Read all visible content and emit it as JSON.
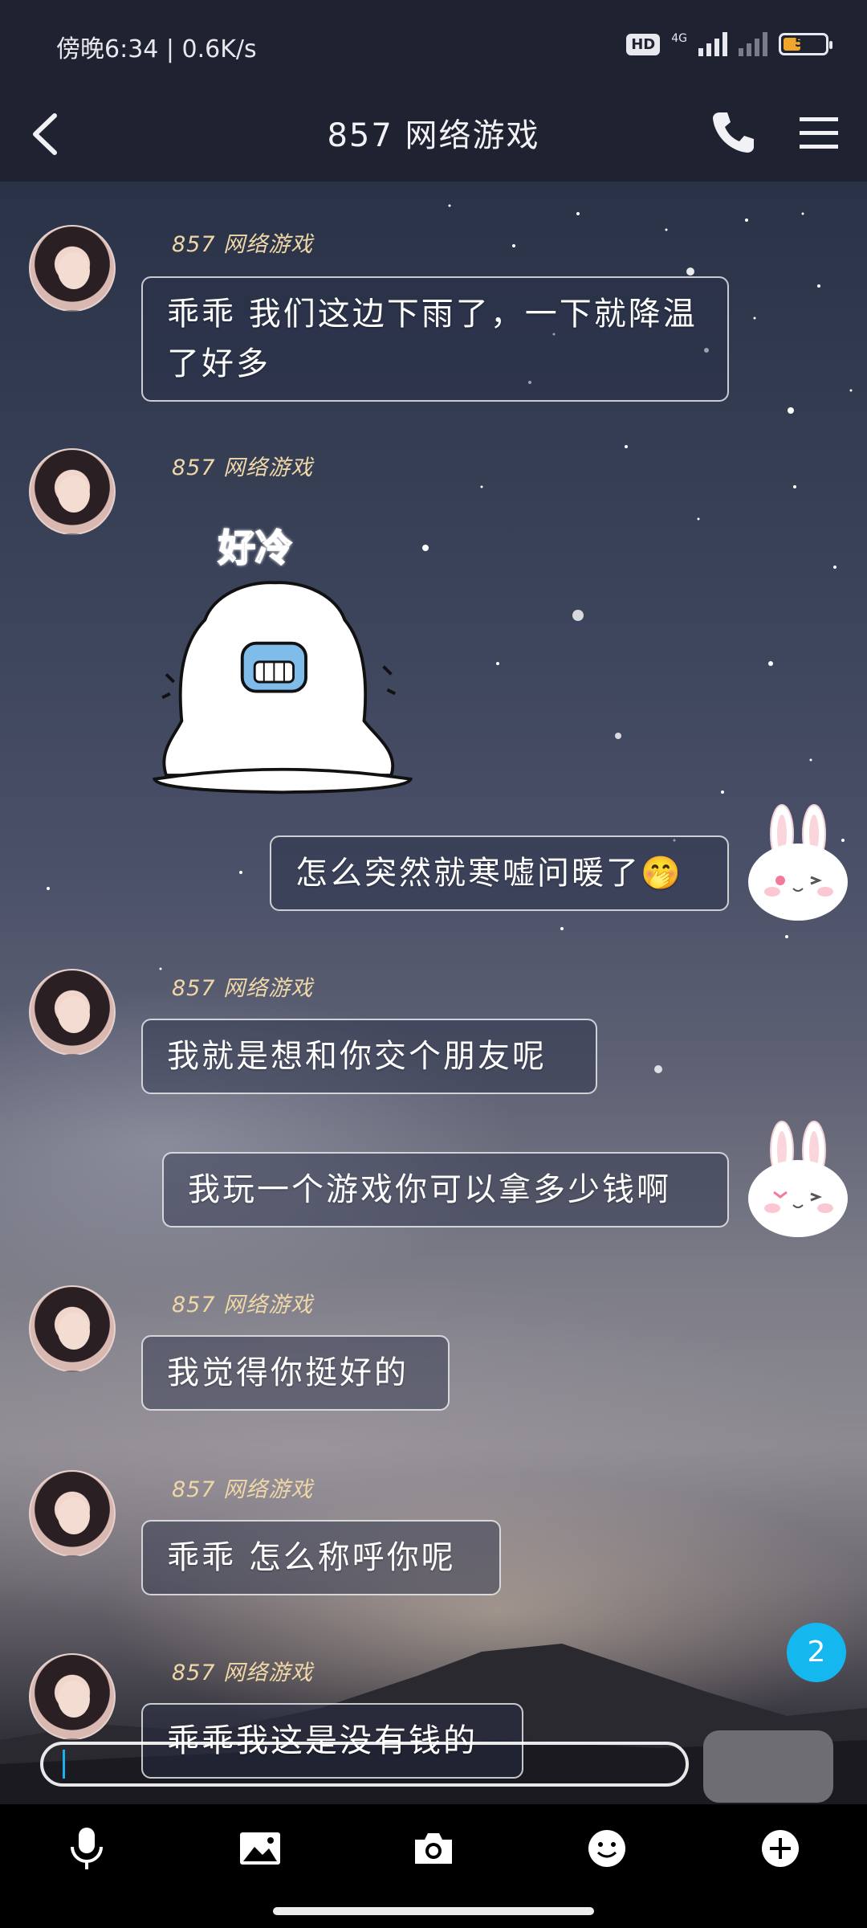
{
  "status_bar": {
    "time_speed": "傍晚6:34 | 0.6K/s",
    "hd_badge": "HD",
    "network": "4G",
    "battery": "53"
  },
  "header": {
    "back_icon": "chevron-left-icon",
    "title": "857 网络游戏",
    "phone_icon": "phone-icon",
    "menu_icon": "hamburger-menu-icon"
  },
  "messages": [
    {
      "side": "left",
      "sender": "857 网络游戏",
      "text": "乖乖 我们这边下雨了，一下就降温了好多"
    },
    {
      "side": "left",
      "sender": "857 网络游戏",
      "type": "sticker",
      "sticker_text": "好冷"
    },
    {
      "side": "right",
      "text": "怎么突然就寒嘘问暖了🤭"
    },
    {
      "side": "left",
      "sender": "857 网络游戏",
      "text": "我就是想和你交个朋友呢"
    },
    {
      "side": "right",
      "text": "我玩一个游戏你可以拿多少钱啊"
    },
    {
      "side": "left",
      "sender": "857 网络游戏",
      "text": "我觉得你挺好的"
    },
    {
      "side": "left",
      "sender": "857 网络游戏",
      "text": "乖乖 怎么称呼你呢"
    },
    {
      "side": "left",
      "sender": "857 网络游戏",
      "text": "乖乖我这是没有钱的"
    }
  ],
  "unread_count": "2",
  "toolbar": {
    "items": [
      "microphone-icon",
      "image-icon",
      "camera-icon",
      "emoji-icon",
      "plus-icon"
    ]
  },
  "colors": {
    "header_bg": "#1f2231",
    "sender_name": "#efd7a8",
    "unread_badge": "#14b7ee",
    "caret": "#1ab0f0"
  }
}
